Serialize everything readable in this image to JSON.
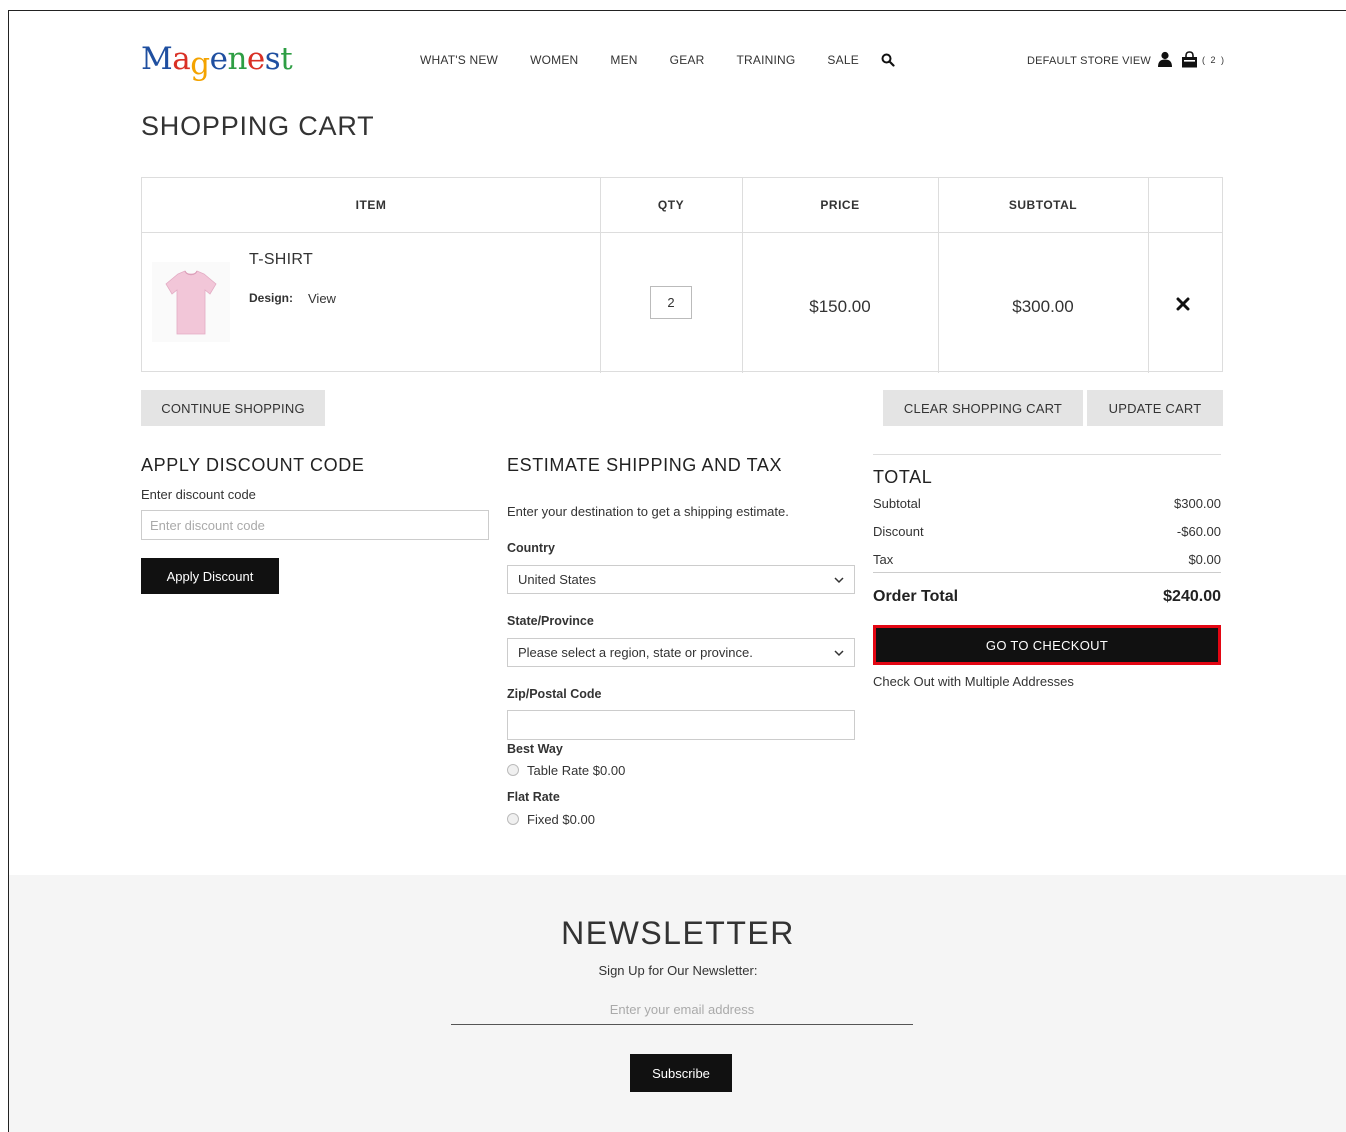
{
  "brand": {
    "logo_letters": [
      {
        "ch": "M",
        "color": "#1f4fa0"
      },
      {
        "ch": "a",
        "color": "#d93025"
      },
      {
        "ch": "g",
        "color": "#f4a300"
      },
      {
        "ch": "e",
        "color": "#1f4fa0"
      },
      {
        "ch": "n",
        "color": "#2e9e44"
      },
      {
        "ch": "e",
        "color": "#d93025"
      },
      {
        "ch": "s",
        "color": "#1f4fa0"
      },
      {
        "ch": "t",
        "color": "#2e9e44"
      }
    ]
  },
  "nav": {
    "items": [
      "WHAT'S NEW",
      "WOMEN",
      "MEN",
      "GEAR",
      "TRAINING",
      "SALE"
    ],
    "store_view": "DEFAULT STORE VIEW",
    "cart_count": "( 2 )"
  },
  "page": {
    "title": "SHOPPING CART"
  },
  "cart": {
    "headers": {
      "item": "ITEM",
      "qty": "QTY",
      "price": "PRICE",
      "subtotal": "SUBTOTAL"
    },
    "item": {
      "name": "T-SHIRT",
      "design_label": "Design:",
      "design_link": "View",
      "qty": "2",
      "price": "$150.00",
      "subtotal": "$300.00",
      "image_color": "#f2c6d8"
    },
    "buttons": {
      "continue": "CONTINUE SHOPPING",
      "clear": "CLEAR SHOPPING CART",
      "update": "UPDATE CART"
    }
  },
  "discount": {
    "heading": "APPLY DISCOUNT CODE",
    "label": "Enter discount code",
    "placeholder": "Enter discount code",
    "button": "Apply Discount"
  },
  "shipping": {
    "heading": "ESTIMATE SHIPPING AND TAX",
    "intro": "Enter your destination to get a shipping estimate.",
    "country_label": "Country",
    "country_value": "United States",
    "state_label": "State/Province",
    "state_value": "Please select a region, state or province.",
    "zip_label": "Zip/Postal Code",
    "methods": [
      {
        "title": "Best Way",
        "option": "Table Rate $0.00"
      },
      {
        "title": "Flat Rate",
        "option": "Fixed $0.00"
      }
    ]
  },
  "totals": {
    "heading": "TOTAL",
    "subtotal_label": "Subtotal",
    "subtotal_value": "$300.00",
    "discount_label": "Discount",
    "discount_value": "-$60.00",
    "tax_label": "Tax",
    "tax_value": "$0.00",
    "order_total_label": "Order Total",
    "order_total_value": "$240.00",
    "checkout": "GO TO CHECKOUT",
    "multi_address": "Check Out with Multiple Addresses"
  },
  "newsletter": {
    "title": "NEWSLETTER",
    "subtitle": "Sign Up for Our Newsletter:",
    "placeholder": "Enter your email address",
    "button": "Subscribe"
  },
  "colors": {
    "highlight": "#e30613",
    "button_dark": "#111111",
    "footer_bg": "#f5f5f5"
  }
}
